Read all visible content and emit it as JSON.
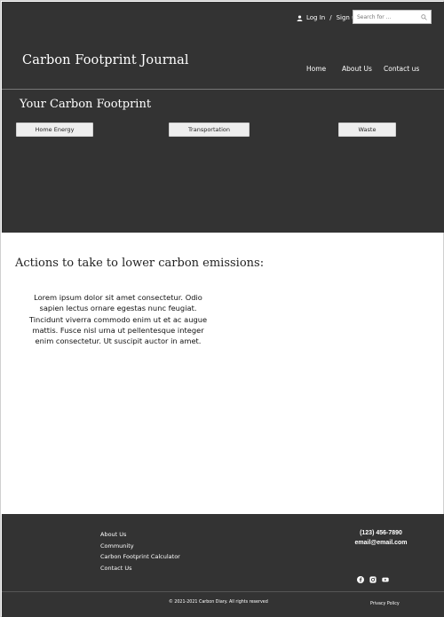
{
  "header": {
    "login_label": "Log In",
    "separator": "/",
    "signup_label": "Sign up",
    "search_placeholder": "Search for ...",
    "site_title": "Carbon Footprint Journal",
    "nav": [
      "Home",
      "About Us",
      "Contact us"
    ]
  },
  "band": {
    "title": "Your Carbon Footprint",
    "categories": [
      "Home Energy",
      "Transportation",
      "Waste"
    ]
  },
  "main": {
    "actions_title": "Actions to take to lower carbon emissions:",
    "body": "Lorem ipsum dolor sit amet consectetur. Odio sapien lectus ornare egestas nunc feugiat. Tincidunt viverra commodo enim ut et ac augue mattis. Fusce nisl urna ut pellentesque integer enim consectetur. Ut suscipit auctor in amet."
  },
  "footer": {
    "links": [
      "About Us",
      "Community",
      "Carbon Footprint Calculator",
      "Contact Us"
    ],
    "phone": "(123) 456-7890",
    "email": "email@email.com",
    "social_icons": [
      "facebook-icon",
      "instagram-icon",
      "youtube-icon"
    ],
    "copyright": "© 2021-2021 Carbon Diary. All rights reserved",
    "privacy": "Privacy Policy"
  },
  "colors": {
    "dark": "#333333",
    "button": "#eeeeee",
    "text_light": "#ffffff"
  }
}
